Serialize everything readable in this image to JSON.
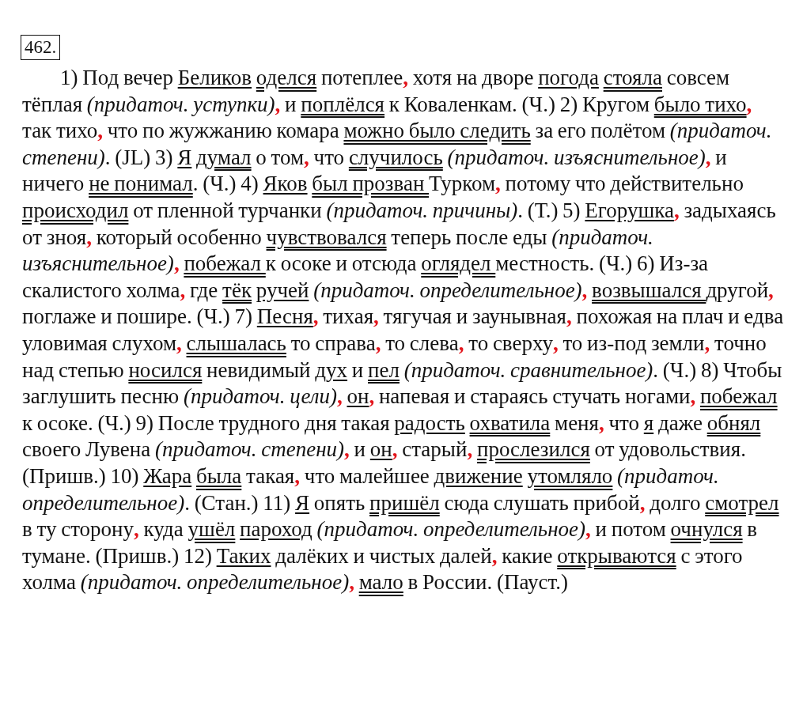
{
  "exercise_number": "462.",
  "segments": [
    {
      "kind": "plain",
      "text": "1) Под вечер "
    },
    {
      "kind": "subject",
      "text": "Беликов"
    },
    {
      "kind": "predicate",
      "text": " оделся"
    },
    {
      "kind": "plain",
      "text": " потеплее"
    },
    {
      "kind": "comma",
      "text": ","
    },
    {
      "kind": "plain",
      "text": " хотя на дворе "
    },
    {
      "kind": "subject",
      "text": "погода"
    },
    {
      "kind": "predicate",
      "text": " стояла"
    },
    {
      "kind": "plain",
      "text": " совсем тёплая "
    },
    {
      "kind": "note",
      "text": "(придаточ. уступки)"
    },
    {
      "kind": "comma",
      "text": ","
    },
    {
      "kind": "plain",
      "text": " и "
    },
    {
      "kind": "predicate",
      "text": "поплёлся"
    },
    {
      "kind": "plain",
      "text": " к Коваленкам. (Ч.) 2) Кругом "
    },
    {
      "kind": "predicate",
      "text": "было тихо"
    },
    {
      "kind": "comma",
      "text": ","
    },
    {
      "kind": "plain",
      "text": " так тихо"
    },
    {
      "kind": "comma",
      "text": ","
    },
    {
      "kind": "plain",
      "text": " что по жужжанию комара "
    },
    {
      "kind": "predicate",
      "text": "можно было следить"
    },
    {
      "kind": "plain",
      "text": " за его полётом "
    },
    {
      "kind": "note",
      "text": "(придаточ. степени)"
    },
    {
      "kind": "plain",
      "text": ". (JL) 3) "
    },
    {
      "kind": "subject",
      "text": "Я"
    },
    {
      "kind": "predicate",
      "text": " думал"
    },
    {
      "kind": "plain",
      "text": " о том"
    },
    {
      "kind": "comma",
      "text": ","
    },
    {
      "kind": "plain",
      "text": " что "
    },
    {
      "kind": "predicate",
      "text": "случилось"
    },
    {
      "kind": "note",
      "text": " (придаточ. изъяснительное)"
    },
    {
      "kind": "comma",
      "text": ","
    },
    {
      "kind": "plain",
      "text": " и ничего "
    },
    {
      "kind": "predicate",
      "text": "не понимал"
    },
    {
      "kind": "plain",
      "text": ". (Ч.) 4) "
    },
    {
      "kind": "subject",
      "text": "Яков"
    },
    {
      "kind": "predicate",
      "text": " был прозван "
    },
    {
      "kind": "plain",
      "text": "Турком"
    },
    {
      "kind": "comma",
      "text": ","
    },
    {
      "kind": "plain",
      "text": " потому что действительно "
    },
    {
      "kind": "predicate",
      "text": "происходил"
    },
    {
      "kind": "plain",
      "text": " от пленной турчанки "
    },
    {
      "kind": "note",
      "text": "(придаточ. причины)"
    },
    {
      "kind": "plain",
      "text": ". (Т.) 5) "
    },
    {
      "kind": "subject",
      "text": "Егорушка"
    },
    {
      "kind": "comma",
      "text": ","
    },
    {
      "kind": "plain",
      "text": " задыхаясь от зноя"
    },
    {
      "kind": "comma",
      "text": ","
    },
    {
      "kind": "plain",
      "text": " который особенно "
    },
    {
      "kind": "predicate",
      "text": "чувствовался"
    },
    {
      "kind": "plain",
      "text": " теперь после еды "
    },
    {
      "kind": "note",
      "text": "(придаточ. изъяснительное)"
    },
    {
      "kind": "comma",
      "text": ","
    },
    {
      "kind": "predicate",
      "text": " побежал "
    },
    {
      "kind": "plain",
      "text": "к осоке и отсюда "
    },
    {
      "kind": "predicate",
      "text": "оглядел "
    },
    {
      "kind": "plain",
      "text": "местность. (Ч.) 6) Из-за скалистого холма"
    },
    {
      "kind": "comma",
      "text": ","
    },
    {
      "kind": "plain",
      "text": " где "
    },
    {
      "kind": "predicate",
      "text": "тёк"
    },
    {
      "kind": "subject",
      "text": " ручей"
    },
    {
      "kind": "note",
      "text": " (придаточ. определительное)"
    },
    {
      "kind": "comma",
      "text": ","
    },
    {
      "kind": "predicate",
      "text": " возвышался "
    },
    {
      "kind": "plain",
      "text": "другой"
    },
    {
      "kind": "comma",
      "text": ","
    },
    {
      "kind": "plain",
      "text": " поглаже и пошире. (Ч.) 7) "
    },
    {
      "kind": "subject",
      "text": "Песня"
    },
    {
      "kind": "comma",
      "text": ","
    },
    {
      "kind": "plain",
      "text": " тихая"
    },
    {
      "kind": "comma",
      "text": ","
    },
    {
      "kind": "plain",
      "text": " тягучая и заунывная"
    },
    {
      "kind": "comma",
      "text": ","
    },
    {
      "kind": "plain",
      "text": " похожая на плач и едва уловимая слухом"
    },
    {
      "kind": "comma",
      "text": ","
    },
    {
      "kind": "predicate",
      "text": " слышалась"
    },
    {
      "kind": "plain",
      "text": " то справа"
    },
    {
      "kind": "comma",
      "text": ","
    },
    {
      "kind": "plain",
      "text": " то слева"
    },
    {
      "kind": "comma",
      "text": ","
    },
    {
      "kind": "plain",
      "text": " то сверху"
    },
    {
      "kind": "comma",
      "text": ","
    },
    {
      "kind": "plain",
      "text": " то из-под земли"
    },
    {
      "kind": "comma",
      "text": ","
    },
    {
      "kind": "plain",
      "text": " точно над степью "
    },
    {
      "kind": "predicate",
      "text": "носился"
    },
    {
      "kind": "plain",
      "text": " невидимый "
    },
    {
      "kind": "subject",
      "text": "дух"
    },
    {
      "kind": "plain",
      "text": " и "
    },
    {
      "kind": "predicate",
      "text": "пел"
    },
    {
      "kind": "note",
      "text": " (придаточ. сравнительное)"
    },
    {
      "kind": "plain",
      "text": ". (Ч.) 8) Чтобы заглушить песню "
    },
    {
      "kind": "note",
      "text": "(придаточ. цели)"
    },
    {
      "kind": "comma",
      "text": ","
    },
    {
      "kind": "subject",
      "text": " он"
    },
    {
      "kind": "comma",
      "text": ","
    },
    {
      "kind": "plain",
      "text": " напевая и стараясь стучать ногами"
    },
    {
      "kind": "comma",
      "text": ","
    },
    {
      "kind": "predicate",
      "text": " побежал"
    },
    {
      "kind": "plain",
      "text": " к осоке. (Ч.) 9) После трудного дня такая "
    },
    {
      "kind": "subject",
      "text": "радость"
    },
    {
      "kind": "predicate",
      "text": " охватила"
    },
    {
      "kind": "plain",
      "text": " меня"
    },
    {
      "kind": "comma",
      "text": ","
    },
    {
      "kind": "plain",
      "text": " что "
    },
    {
      "kind": "subject",
      "text": "я"
    },
    {
      "kind": "plain",
      "text": " даже "
    },
    {
      "kind": "predicate",
      "text": "обнял"
    },
    {
      "kind": "plain",
      "text": " своего Лувена "
    },
    {
      "kind": "note",
      "text": "(придаточ. степени)"
    },
    {
      "kind": "comma",
      "text": ","
    },
    {
      "kind": "plain",
      "text": " и "
    },
    {
      "kind": "subject",
      "text": "он"
    },
    {
      "kind": "comma",
      "text": ","
    },
    {
      "kind": "plain",
      "text": " старый"
    },
    {
      "kind": "comma",
      "text": ","
    },
    {
      "kind": "predicate",
      "text": " прослезился"
    },
    {
      "kind": "plain",
      "text": " от удовольствия. (Пришв.) 10) "
    },
    {
      "kind": "subject",
      "text": "Жара"
    },
    {
      "kind": "predicate",
      "text": " была"
    },
    {
      "kind": "plain",
      "text": " такая"
    },
    {
      "kind": "comma",
      "text": ","
    },
    {
      "kind": "plain",
      "text": " что малейшее "
    },
    {
      "kind": "subject",
      "text": "движение"
    },
    {
      "kind": "predicate",
      "text": " утомляло"
    },
    {
      "kind": "note",
      "text": " (придаточ. определительное)"
    },
    {
      "kind": "plain",
      "text": ". (Стан.) 11) "
    },
    {
      "kind": "subject",
      "text": "Я"
    },
    {
      "kind": "plain",
      "text": " опять "
    },
    {
      "kind": "predicate",
      "text": "пришёл"
    },
    {
      "kind": "plain",
      "text": " сюда слушать прибой"
    },
    {
      "kind": "comma",
      "text": ","
    },
    {
      "kind": "plain",
      "text": " долго "
    },
    {
      "kind": "predicate",
      "text": "смотрел"
    },
    {
      "kind": "plain",
      "text": " в ту сторону"
    },
    {
      "kind": "comma",
      "text": ","
    },
    {
      "kind": "plain",
      "text": " куда "
    },
    {
      "kind": "predicate",
      "text": "ушёл"
    },
    {
      "kind": "subject",
      "text": " пароход"
    },
    {
      "kind": "note",
      "text": " (придаточ. определительное)"
    },
    {
      "kind": "comma",
      "text": ","
    },
    {
      "kind": "plain",
      "text": " и потом "
    },
    {
      "kind": "predicate",
      "text": "очнулся"
    },
    {
      "kind": "plain",
      "text": " в тумане. (Пришв.) 12) "
    },
    {
      "kind": "subject",
      "text": "Таких"
    },
    {
      "kind": "plain",
      "text": " далёких и чистых далей"
    },
    {
      "kind": "comma",
      "text": ","
    },
    {
      "kind": "plain",
      "text": " какие "
    },
    {
      "kind": "predicate",
      "text": "открываются"
    },
    {
      "kind": "plain",
      "text": " с этого холма "
    },
    {
      "kind": "note",
      "text": "(придаточ. определительное)"
    },
    {
      "kind": "comma",
      "text": ","
    },
    {
      "kind": "predicate",
      "text": " мало"
    },
    {
      "kind": "plain",
      "text": " в России. (Пауст.)"
    }
  ]
}
